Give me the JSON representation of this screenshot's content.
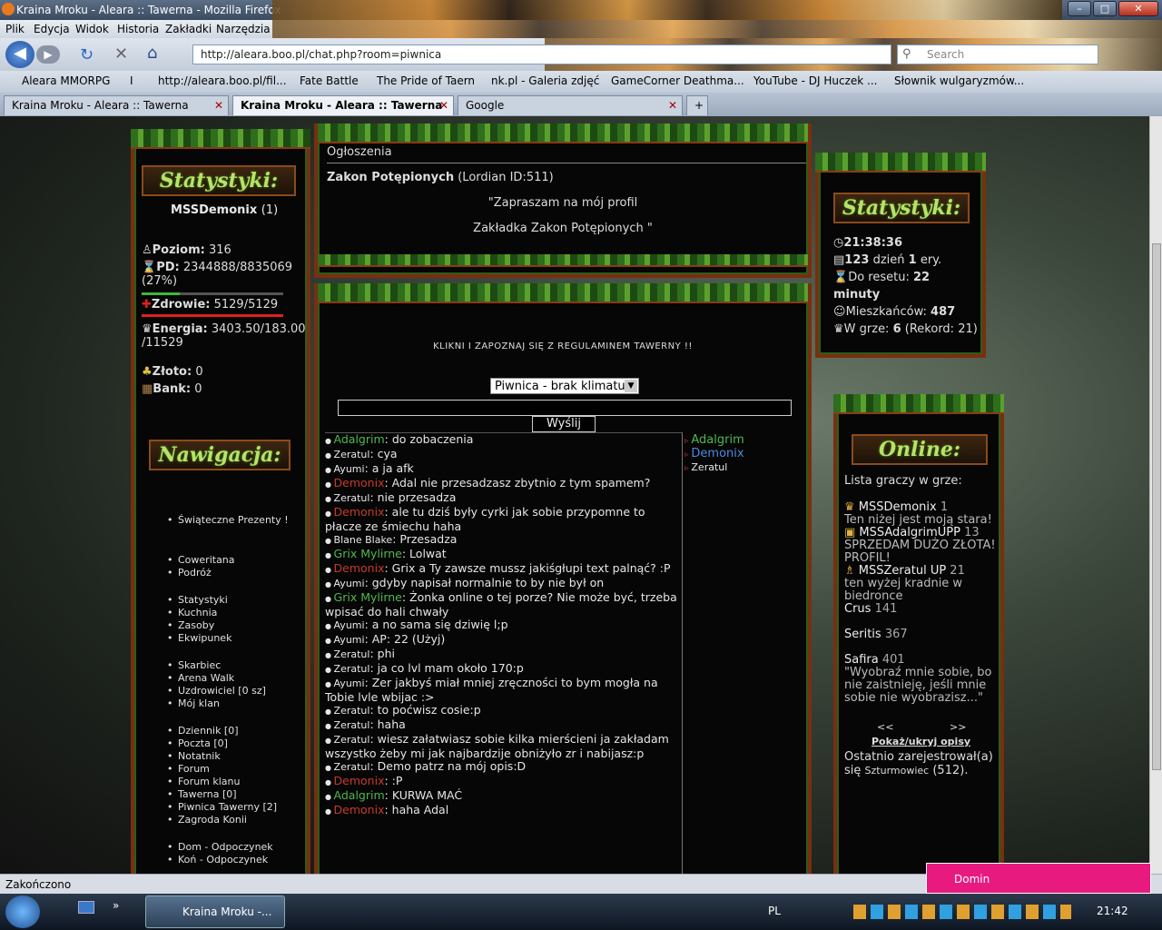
{
  "window": {
    "title": "Kraina Mroku - Aleara :: Tawerna - Mozilla Firefox",
    "buttons": [
      "–",
      "□",
      "✕"
    ]
  },
  "menu": [
    "Plik",
    "Edycja",
    "Widok",
    "Historia",
    "Zakładki",
    "Narzędzia"
  ],
  "nav": {
    "url": "http://aleara.boo.pl/chat.php?room=piwnica",
    "search_placeholder": "Search"
  },
  "bookmarks": [
    "Aleara MMORPG",
    "I",
    "http://aleara.boo.pl/fil...",
    "Fate Battle",
    "The Pride of Taern",
    "nk.pl - Galeria zdjęć",
    "GameCorner Deathma...",
    "YouTube - DJ Huczek ...",
    "Słownik wulgaryzmów..."
  ],
  "tabs": [
    {
      "label": "Kraina Mroku - Aleara :: Tawerna",
      "active": false
    },
    {
      "label": "Kraina Mroku - Aleara :: Tawerna",
      "active": true
    },
    {
      "label": "Google",
      "active": false
    }
  ],
  "left": {
    "stats_header": "Statystyki:",
    "player": "MSSDemonix",
    "player_count": "(1)",
    "poziom_label": "Poziom:",
    "poziom": "316",
    "pd_label": "PD:",
    "pd": "2344888/8835069",
    "pd_pct": "(27%)",
    "pd_fraction": 0.27,
    "zdrowie_label": "Zdrowie:",
    "zdrowie": "5129/5129",
    "zdrowie_fraction": 1.0,
    "energia_label": "Energia:",
    "energia": "3403.50/183.00",
    "energia2": "/11529",
    "zloto_label": "Złoto:",
    "zloto": "0",
    "bank_label": "Bank:",
    "bank": "0",
    "nav_header": "Nawigacja:",
    "nav_groups": [
      [
        "Świąteczne Prezenty !"
      ],
      [
        "Coweritana",
        "Podróż"
      ],
      [
        "Statystyki",
        "Kuchnia",
        "Zasoby",
        "Ekwipunek"
      ],
      [
        "Skarbiec",
        "Arena Walk",
        "Uzdrowiciel [0 sz]",
        "Mój klan"
      ],
      [
        "Dziennik [0]",
        "Poczta [0]",
        "Notatnik",
        "Forum",
        "Forum klanu",
        "Tawerna [0]",
        "Piwnica Tawerny [2]",
        "Zagroda Konii"
      ],
      [
        "Dom - Odpoczynek",
        "Koń - Odpoczynek"
      ]
    ]
  },
  "center": {
    "ogloszenia": "Ogłoszenia",
    "ann_title": "Zakon Potępionych",
    "ann_id": "(Lordian ID:511)",
    "ann_line1": "\"Zapraszam na mój profil",
    "ann_line2": "Zakładka Zakon Potępionych \"",
    "regulamin": "KLIKNI I ZAPOZNAJ SIĘ Z REGULAMINEM TAWERNY !!",
    "room_select": "Piwnica - brak klimatu",
    "send": "Wyślij",
    "chat": [
      {
        "n": "Adalgrim",
        "c": "g",
        "t": ": do zobaczenia"
      },
      {
        "n": "Zeratul",
        "c": "w",
        "t": ": cya"
      },
      {
        "n": "Ayumi",
        "c": "w",
        "t": ": a ja afk"
      },
      {
        "n": "Demonix",
        "c": "r",
        "t": ": Adal nie przesadzasz zbytnio z tym spamem?"
      },
      {
        "n": "Zeratul",
        "c": "w",
        "t": ": nie przesadza"
      },
      {
        "n": "Demonix",
        "c": "r",
        "t": ": ale tu dziś były cyrki jak sobie przypomne to płacze ze śmiechu haha"
      },
      {
        "n": "Blane Blake",
        "c": "w",
        "t": ": Przesadza"
      },
      {
        "n": "Grix Mylirne",
        "c": "g",
        "t": ": Lolwat"
      },
      {
        "n": "Demonix",
        "c": "r",
        "t": ": Grix a Ty zawsze mussz jakiśgłupi text palnąć? :P"
      },
      {
        "n": "Ayumi",
        "c": "w",
        "t": ": gdyby napisał normalnie to by nie był on"
      },
      {
        "n": "Grix Mylirne",
        "c": "g",
        "t": ": Żonka online o tej porze? Nie może być, trzeba wpisać do hali chwały"
      },
      {
        "n": "Ayumi",
        "c": "w",
        "t": ": a no sama się dziwię l;p"
      },
      {
        "n": "Ayumi",
        "c": "w",
        "t": ": AP: 22 (Użyj)"
      },
      {
        "n": "Zeratul",
        "c": "w",
        "t": ": phi"
      },
      {
        "n": "Zeratul",
        "c": "w",
        "t": ": ja co lvl mam około 170:p"
      },
      {
        "n": "Ayumi",
        "c": "w",
        "t": ": Zer jakbyś miał mniej zręczności to bym mogła na Tobie lvle wbijac :>"
      },
      {
        "n": "Zeratul",
        "c": "w",
        "t": ": to poćwisz cosie:p"
      },
      {
        "n": "Zeratul",
        "c": "w",
        "t": ": haha"
      },
      {
        "n": "Zeratul",
        "c": "w",
        "t": ": wiesz załatwiasz sobie kilka mierścieni ja zakładam wszystko żeby mi jak najbardzije obniżyło zr i nabijasz:p"
      },
      {
        "n": "Zeratul",
        "c": "w",
        "t": ": Demo patrz na mój opis:D"
      },
      {
        "n": "Demonix",
        "c": "r",
        "t": ": :P"
      },
      {
        "n": "Adalgrim",
        "c": "g",
        "t": ": KURWA MAĆ"
      },
      {
        "n": "Demonix",
        "c": "r",
        "t": ": haha Adal"
      }
    ],
    "users": [
      {
        "n": "Adalgrim",
        "c": "g"
      },
      {
        "n": "Demonix",
        "c": "bl"
      },
      {
        "n": "Zeratul",
        "c": "w"
      }
    ]
  },
  "right": {
    "stats_header": "Statystyki:",
    "time": "21:38:36",
    "day": "123",
    "day_label": "dzień",
    "era": "1",
    "era_label": "ery.",
    "reset_label": "Do resetu:",
    "reset": "22",
    "reset_unit": "minuty",
    "mieszkancow_label": "Mieszkańców:",
    "mieszkancow": "487",
    "wgrze_label": "W grze:",
    "wgrze": "6",
    "rekord": "(Rekord: 21)",
    "online_header": "Online:",
    "lista": "Lista graczy w grze:",
    "players": [
      {
        "n": "MSSDemonix",
        "lvl": "1",
        "desc": "Ten niżej jest moją stara!"
      },
      {
        "n": "MSSAdalgrimUPP",
        "lvl": "13",
        "desc": "SPRZEDAM DUŻO ZŁOTA! PROFIL!"
      },
      {
        "n": "MSSZeratul UP",
        "lvl": "21",
        "desc": "ten wyżej kradnie w biedronce"
      },
      {
        "n": "Crus",
        "lvl": "141",
        "desc": ""
      },
      {
        "n": "Seritis",
        "lvl": "367",
        "desc": ""
      },
      {
        "n": "Safira",
        "lvl": "401",
        "desc": "\"Wyobraź mnie sobie, bo nie zaistnieję, jeśli mnie sobie nie wyobrazisz...\""
      }
    ],
    "prev": "<<",
    "next": ">>",
    "toggle": "Pokaż/ukryj opisy",
    "last_reg": "Ostatnio zarejestrował(a) się",
    "last_name": "Szturmowiec",
    "last_id": "(512)."
  },
  "status": "Zakończono",
  "notify": "Domin",
  "taskbar": {
    "task": "Kraina Mroku -...",
    "lang": "PL",
    "clock": "21:42"
  }
}
